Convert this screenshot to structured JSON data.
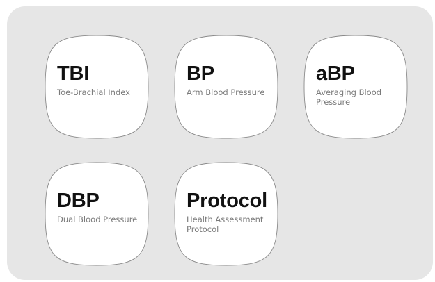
{
  "tiles": [
    {
      "code": "TBI",
      "description": "Toe-Brachial Index"
    },
    {
      "code": "BP",
      "description": "Arm Blood Pressure"
    },
    {
      "code": "aBP",
      "description": "Averaging Blood Pressure"
    },
    {
      "code": "DBP",
      "description": "Dual Blood Pressure"
    },
    {
      "code": "Protocol",
      "description": "Health Assessment Protocol"
    }
  ]
}
